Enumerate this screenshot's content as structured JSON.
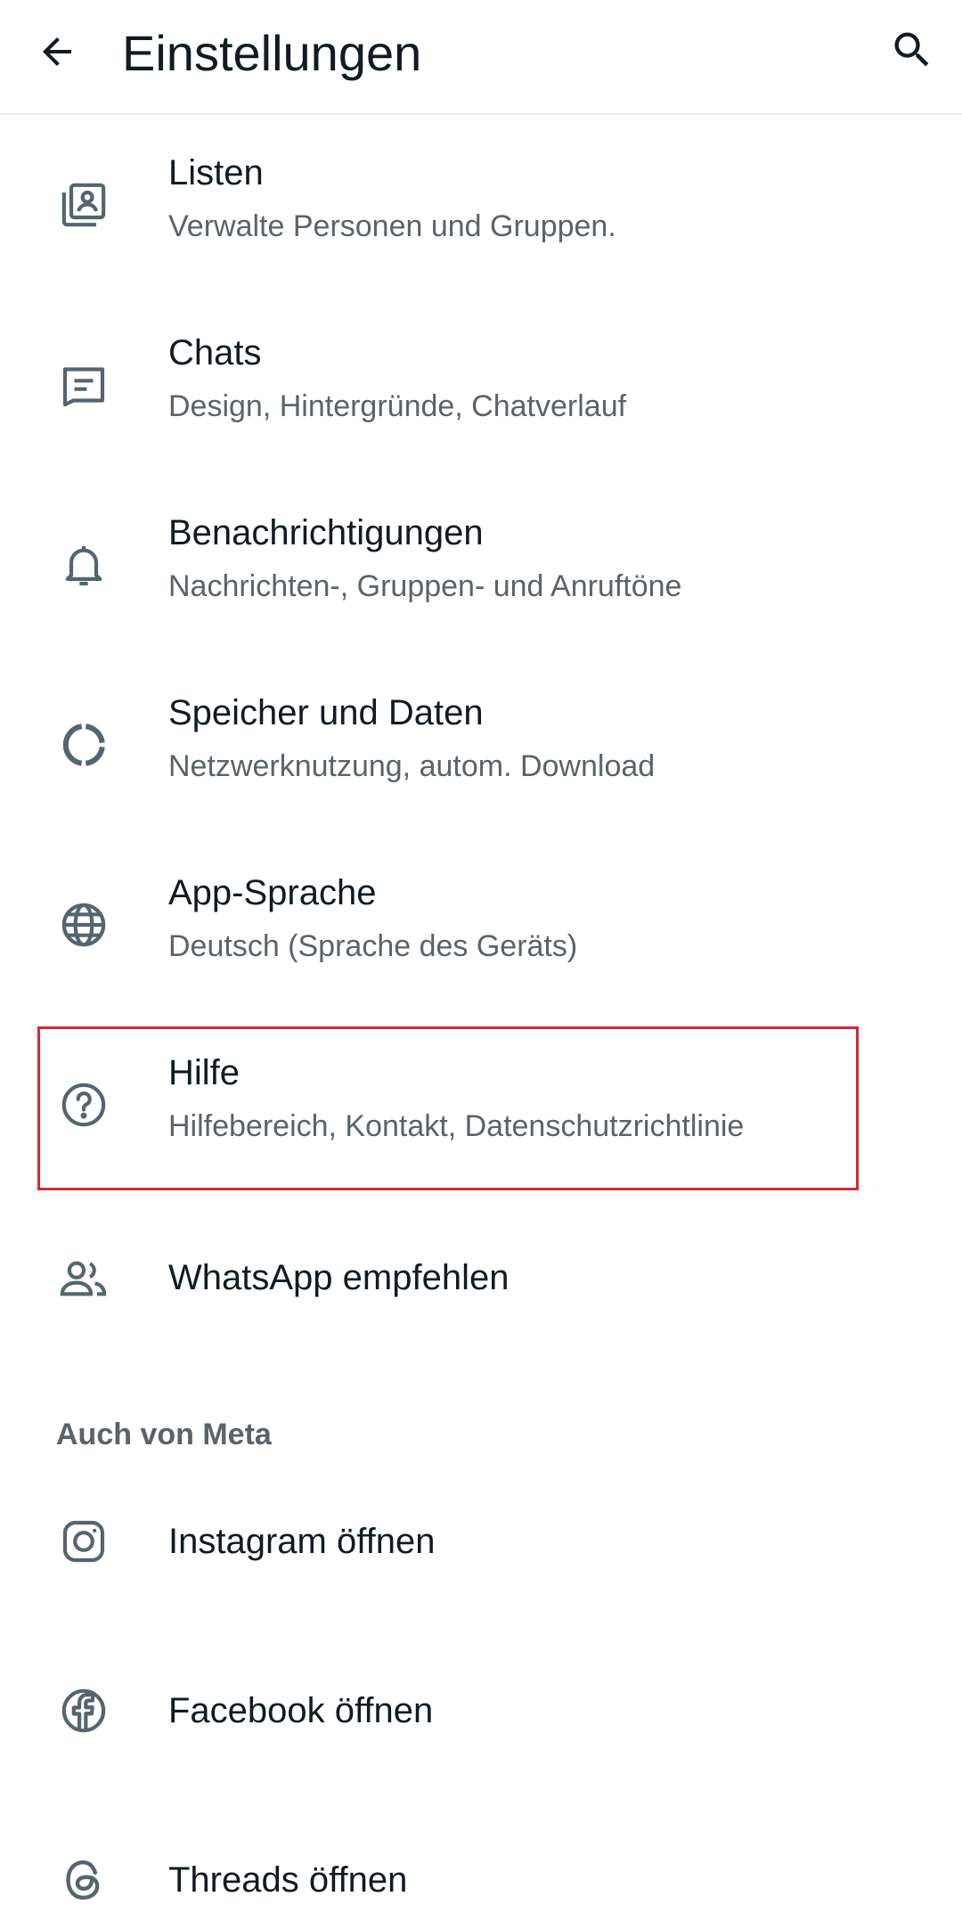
{
  "topbar": {
    "title": "Einstellungen",
    "back_icon": "arrow-left-icon",
    "search_icon": "search-icon"
  },
  "settings": [
    {
      "label": "Listen",
      "sub": "Verwalte Personen und Gruppen.",
      "icon": "lists-icon"
    },
    {
      "label": "Chats",
      "sub": "Design, Hintergründe, Chatverlauf",
      "icon": "chat-icon"
    },
    {
      "label": "Benachrichtigungen",
      "sub": "Nachrichten-, Gruppen- und Anruftöne",
      "icon": "bell-icon"
    },
    {
      "label": "Speicher und Daten",
      "sub": "Netzwerknutzung, autom. Download",
      "icon": "storage-icon"
    },
    {
      "label": "App-Sprache",
      "sub": "Deutsch (Sprache des Geräts)",
      "icon": "globe-icon"
    },
    {
      "label": "Hilfe",
      "sub": "Hilfebereich, Kontakt, Datenschutzrichtlinie",
      "icon": "help-icon"
    },
    {
      "label": "WhatsApp empfehlen",
      "icon": "people-icon"
    }
  ],
  "meta_section": {
    "header": "Auch von Meta",
    "items": [
      {
        "label": "Instagram öffnen",
        "icon": "instagram-icon"
      },
      {
        "label": "Facebook öffnen",
        "icon": "facebook-icon"
      },
      {
        "label": "Threads öffnen",
        "icon": "threads-icon"
      }
    ]
  },
  "colors": {
    "text_primary": "#111b21",
    "text_secondary": "#5b6368",
    "icon": "#54656f",
    "highlight": "#d62839"
  }
}
